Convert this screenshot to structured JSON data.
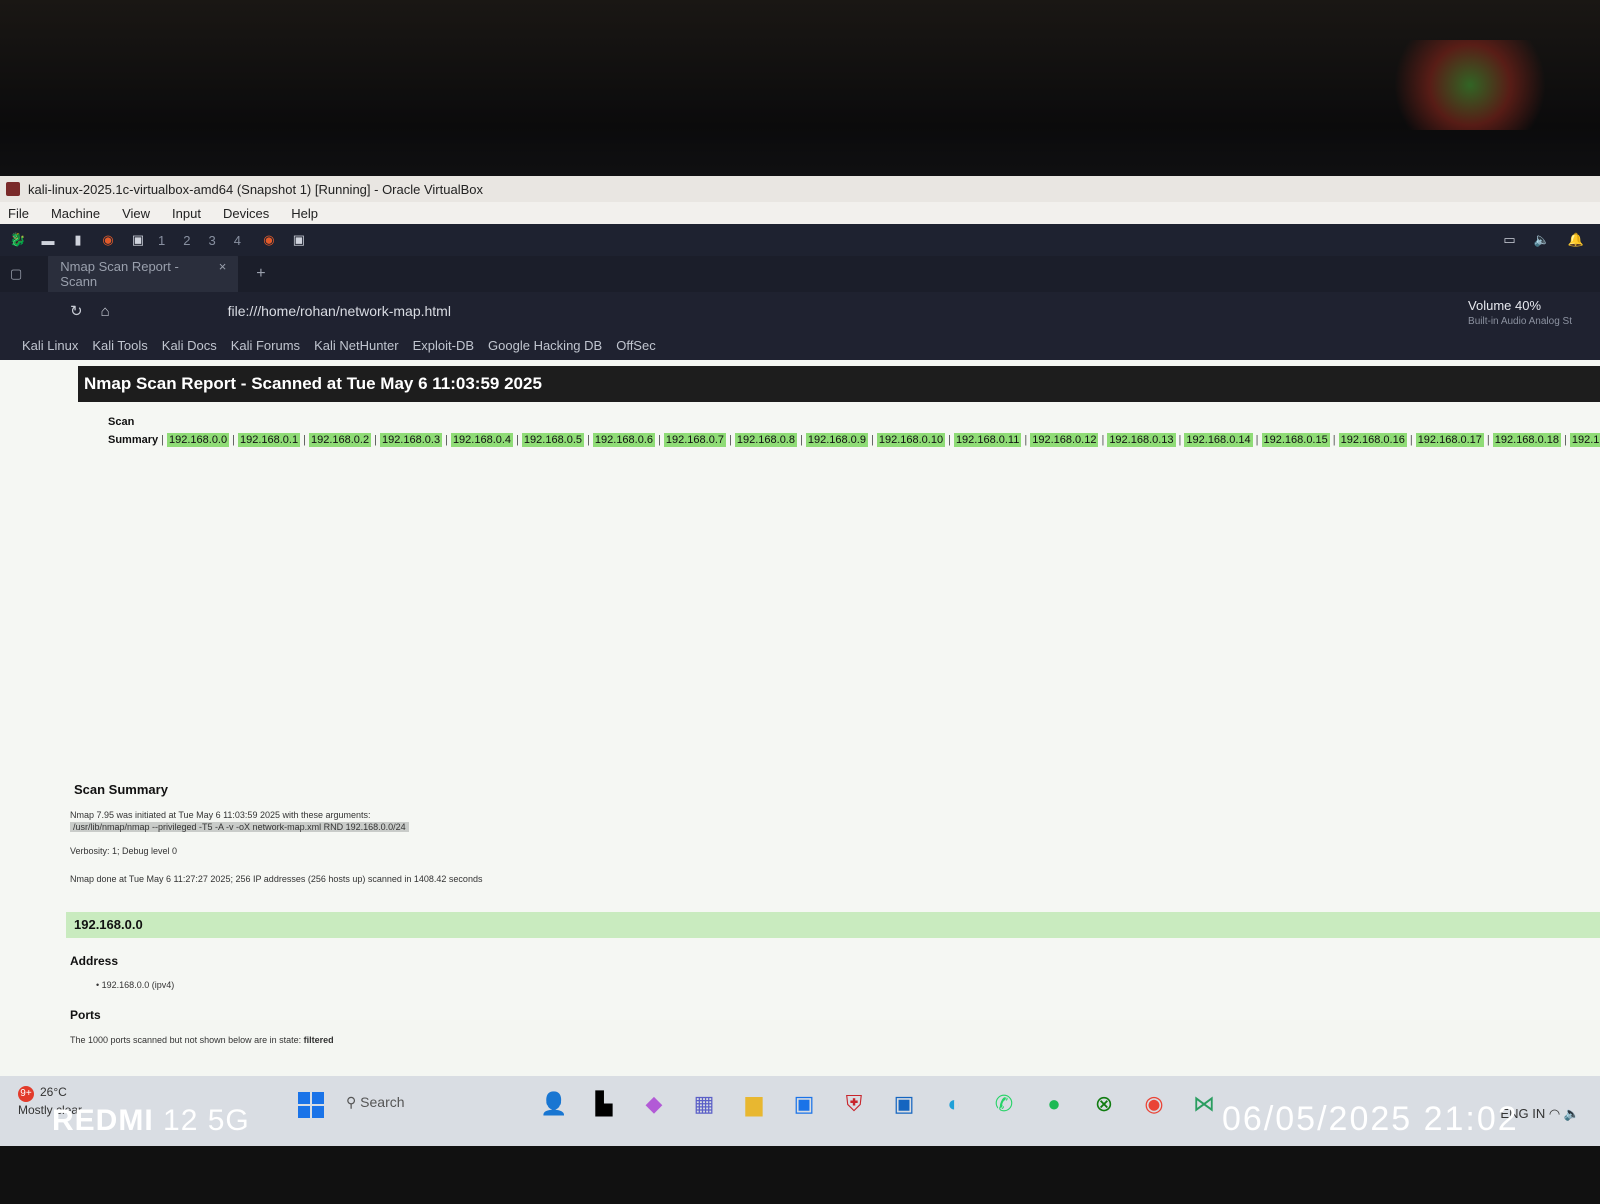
{
  "window": {
    "title": "kali-linux-2025.1c-virtualbox-amd64 (Snapshot 1) [Running] - Oracle VirtualBox",
    "menu": [
      "File",
      "Machine",
      "View",
      "Input",
      "Devices",
      "Help"
    ]
  },
  "panel": {
    "workspaces": [
      "1",
      "2",
      "3",
      "4"
    ]
  },
  "browser": {
    "tab_label": "Nmap Scan Report - Scann",
    "tab_close": "×",
    "new_tab": "+",
    "url": "file:///home/rohan/network-map.html",
    "volume_title": "Volume 40%",
    "volume_sub": "Built-in Audio Analog St",
    "bookmarks": [
      "Kali Linux",
      "Kali Tools",
      "Kali Docs",
      "Kali Forums",
      "Kali NetHunter",
      "Exploit-DB",
      "Google Hacking DB",
      "OffSec"
    ]
  },
  "report": {
    "title": "Nmap Scan Report - Scanned at Tue May 6 11:03:59 2025",
    "summary_link": "Scan Summary",
    "ip_prefix": "192.168.0.",
    "ip_count": 256,
    "section_title": "Scan Summary",
    "initiated": "Nmap 7.95 was initiated at Tue May 6 11:03:59 2025 with these arguments:",
    "arguments": "/usr/lib/nmap/nmap --privileged -T5 -A -v -oX network-map.xml RND 192.168.0.0/24",
    "verbosity": "Verbosity: 1; Debug level 0",
    "done": "Nmap done at Tue May 6 11:27:27 2025; 256 IP addresses (256 hosts up) scanned in 1408.42 seconds",
    "host": "192.168.0.0",
    "address_title": "Address",
    "address_item": "192.168.0.0 (ipv4)",
    "ports_title": "Ports",
    "ports_text": "The 1000 ports scanned but not shown below are in state:",
    "ports_state": "filtered"
  },
  "taskbar": {
    "weather_badge": "9+",
    "temp": "26°C",
    "condition": "Mostly clear",
    "search": "Search",
    "lang": "ENG IN"
  },
  "watermark": {
    "brand": "REDMI",
    "model": "12 5G",
    "datetime": "06/05/2025 21:02"
  }
}
